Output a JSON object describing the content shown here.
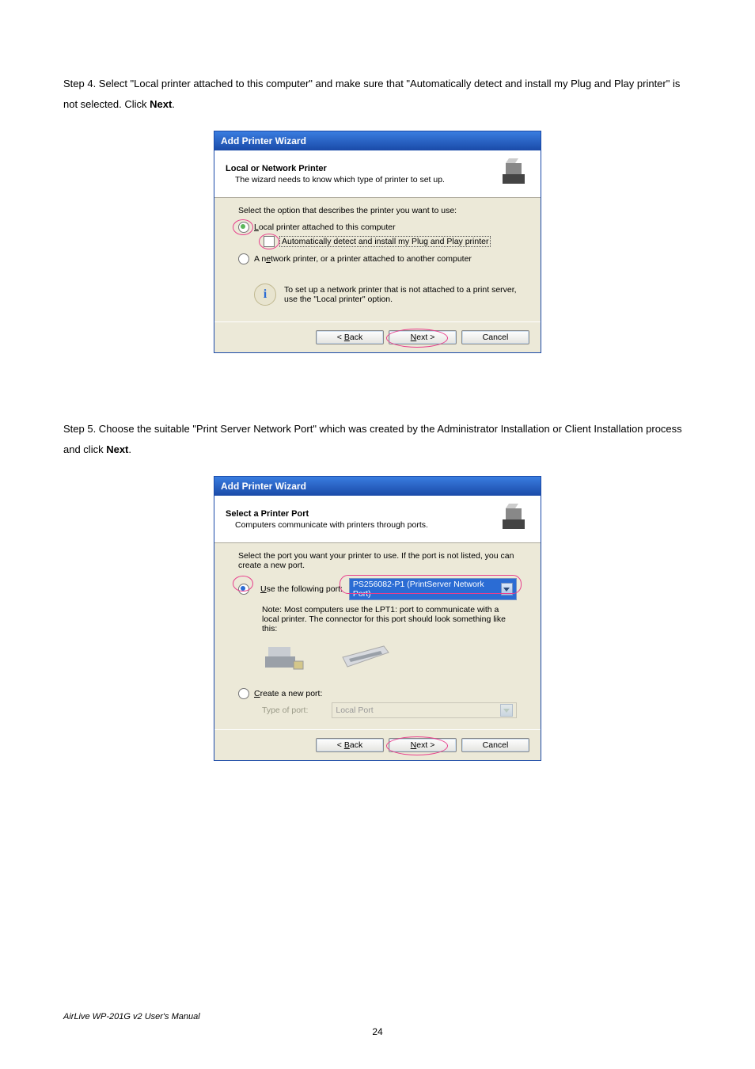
{
  "step4": {
    "text_a": "Step 4. Select \"Local printer attached to this computer\" and make sure that \"Automatically detect and install my Plug and Play printer\" is not selected. Click ",
    "bold": "Next",
    "text_b": "."
  },
  "step5": {
    "text_a": "Step 5. Choose the suitable \"Print Server Network Port\" which was created by the Administrator Installation or Client Installation process and click ",
    "bold": "Next",
    "text_b": "."
  },
  "wiz1": {
    "titlebar": "Add Printer Wizard",
    "header_title": "Local or Network Printer",
    "header_sub": "The wizard needs to know which type of printer to set up.",
    "prompt": "Select the option that describes the printer you want to use:",
    "opt_local": "Local printer attached to this computer",
    "opt_local_key": "L",
    "auto_detect": "Automatically detect and install my Plug and Play printer",
    "opt_network": "A network printer, or a printer attached to another computer",
    "opt_network_key": "e",
    "info": "To set up a network printer that is not attached to a print server, use the \"Local printer\" option.",
    "back": "< Back",
    "next": "Next >",
    "cancel": "Cancel"
  },
  "wiz2": {
    "titlebar": "Add Printer Wizard",
    "header_title": "Select a Printer Port",
    "header_sub": "Computers communicate with printers through ports.",
    "prompt": "Select the port you want your printer to use.  If the port is not listed, you can create a new port.",
    "opt_use": "Use the following port:",
    "opt_use_key": "U",
    "port_value": "PS256082-P1 (PrintServer Network Port)",
    "note": "Note: Most computers use the LPT1: port to communicate with a local printer. The connector for this port should look something like this:",
    "opt_create": "Create a new port:",
    "opt_create_key": "C",
    "type_of_port_label": "Type of port:",
    "type_of_port_value": "Local Port",
    "back": "< Back",
    "next": "Next >",
    "cancel": "Cancel"
  },
  "footer": {
    "manual": "AirLive WP-201G v2 User's Manual",
    "page": "24"
  }
}
